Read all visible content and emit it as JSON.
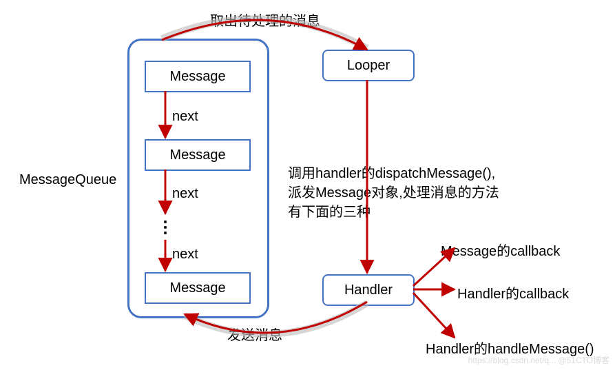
{
  "diagram": {
    "queueLabel": "MessageQueue",
    "queueItems": [
      "Message",
      "Message",
      "Message"
    ],
    "nextLabels": [
      "next",
      "next",
      "next"
    ],
    "looperLabel": "Looper",
    "handlerLabel": "Handler",
    "topArrowLabel": "取出待处理的消息",
    "bottomArrowLabel": "发送消息",
    "midDescription1": "调用handler的dispatchMessage(),",
    "midDescription2": "派发Message对象,处理消息的方法",
    "midDescription3": "有下面的三种",
    "outcome1": "Message的callback",
    "outcome2": "Handler的callback",
    "outcome3": "Handler的handleMessage()",
    "watermark": "https://blog.csdn.net/q... @51CTO博客"
  }
}
